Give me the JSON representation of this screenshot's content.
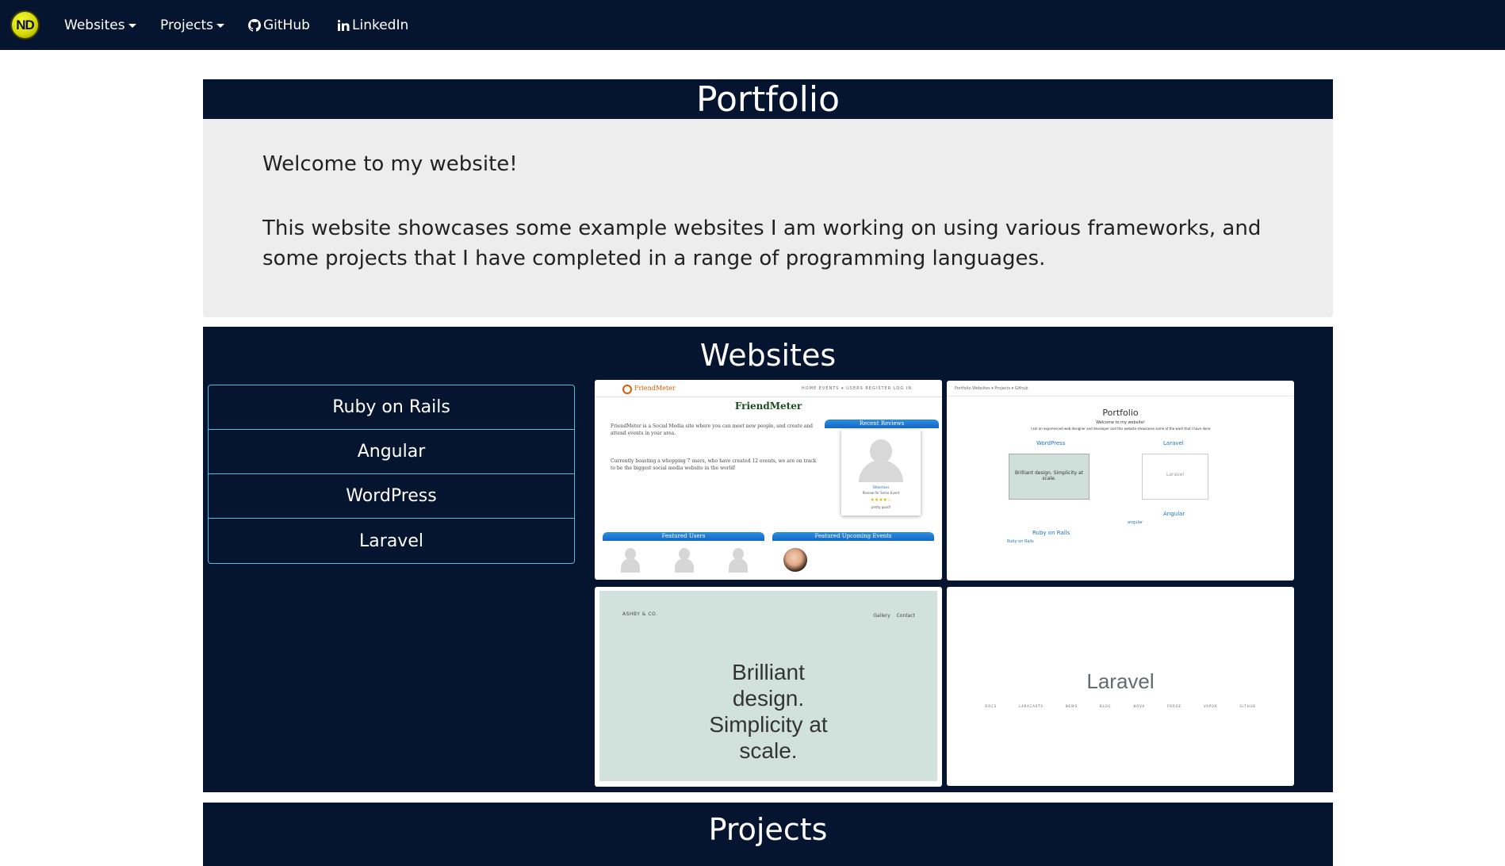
{
  "navbar": {
    "logo_text": "ND",
    "websites_label": "Websites",
    "projects_label": "Projects",
    "github_label": "GitHub",
    "linkedin_label": "LinkedIn",
    "background_color": "#051530"
  },
  "portfolio": {
    "title": "Portfolio",
    "welcome": "Welcome to my website!",
    "description": "This website showcases some example websites I am working on using various frameworks, and some projects that I have completed in a range of programming languages."
  },
  "websites": {
    "title": "Websites",
    "frameworks": [
      {
        "label": "Ruby on Rails"
      },
      {
        "label": "Angular"
      },
      {
        "label": "WordPress"
      },
      {
        "label": "Laravel"
      }
    ],
    "accent_border": "#5bb8e0",
    "thumbnails": {
      "friendmeter": {
        "logo_text": "FriendMeter",
        "nav_links": "HOME   EVENTS ▾   USERS   REGISTER   LOG IN",
        "title": "FriendMeter",
        "intro": "FriendMeter is a Social Media site where you can meet new people, and create and attend events in your area.",
        "stats": "Currently boasting a whopping 7 users, who have created 12 events, we are on track to be the biggest social media website in the world!",
        "recent_reviews": "Recent Reviews",
        "review_user": "OtherUser",
        "review_for": "Review for Some Event",
        "review_stars": "★★★★☆",
        "review_text": "pretty good!",
        "featured_users": "Featured Users",
        "featured_events": "Featured Upcoming Events"
      },
      "portfolio_site": {
        "nav_text": "Portfolio   Websites ▾   Projects ▾   Github",
        "title": "Portfolio",
        "welcome": "Welcome to my website!",
        "subtitle": "I am an experienced web designer and developer and this website showcases some of the work that I have done",
        "wordpress": "WordPress",
        "laravel": "Laravel",
        "angular": "Angular",
        "angular_small": "angular",
        "ruby": "Ruby on Rails",
        "ruby_small": "Ruby on Rails",
        "mini_text": "Brilliant design. Simplicity at scale.",
        "mini_laravel": "Laravel"
      },
      "ashby": {
        "brand": "ASHBY & CO.",
        "links": "Gallery Contact",
        "hero": "Brilliant design. Simplicity at scale."
      },
      "laravel": {
        "title": "Laravel",
        "links": "DOCS LARACASTS NEWS BLOG NOVA FORGE VAPOR GITHUB"
      }
    }
  },
  "projects": {
    "title": "Projects"
  }
}
